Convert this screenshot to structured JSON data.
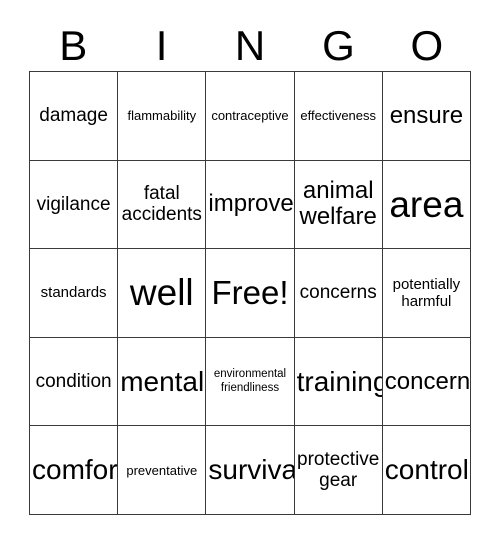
{
  "card": {
    "title": "BINGO",
    "columns": [
      {
        "letter": "B"
      },
      {
        "letter": "I"
      },
      {
        "letter": "N"
      },
      {
        "letter": "G"
      },
      {
        "letter": "O"
      }
    ],
    "colors": {
      "background": "#ffffff",
      "border": "#3a3a3a",
      "text": "#000000"
    },
    "free_space": {
      "row": 2,
      "col": 2,
      "label": "Free!"
    },
    "rows": [
      [
        {
          "text": "damage",
          "size": "ml",
          "lines": 1
        },
        {
          "text": "flammability",
          "size": "xs",
          "lines": 1
        },
        {
          "text": "contraceptive",
          "size": "xs",
          "lines": 1
        },
        {
          "text": "effectiveness",
          "size": "xs",
          "lines": 1
        },
        {
          "text": "ensure",
          "size": "xl",
          "lines": 1
        }
      ],
      [
        {
          "text": "vigilance",
          "size": "ml",
          "lines": 1
        },
        {
          "text": "fatal\naccidents",
          "size": "ml",
          "lines": 2
        },
        {
          "text": "improve",
          "size": "xl",
          "lines": 1
        },
        {
          "text": "animal\nwelfare",
          "size": "xl",
          "lines": 2
        },
        {
          "text": "area",
          "size": "h2",
          "lines": 1
        }
      ],
      [
        {
          "text": "standards",
          "size": "s",
          "lines": 1
        },
        {
          "text": "well",
          "size": "h2",
          "lines": 1
        },
        {
          "text": "Free!",
          "size": "h1",
          "lines": 1
        },
        {
          "text": "concerns",
          "size": "ml",
          "lines": 1
        },
        {
          "text": "potentially\nharmful",
          "size": "s",
          "lines": 2
        }
      ],
      [
        {
          "text": "condition",
          "size": "ml",
          "lines": 1
        },
        {
          "text": "mental",
          "size": "xxl",
          "lines": 1
        },
        {
          "text": "environmental\nfriendliness",
          "size": "xxs",
          "lines": 2
        },
        {
          "text": "training",
          "size": "xxl",
          "lines": 1
        },
        {
          "text": "concern",
          "size": "xl",
          "lines": 1
        }
      ],
      [
        {
          "text": "comfort",
          "size": "xxl",
          "lines": 1
        },
        {
          "text": "preventative",
          "size": "xs",
          "lines": 1
        },
        {
          "text": "survival",
          "size": "xxl",
          "lines": 1
        },
        {
          "text": "protective\ngear",
          "size": "ml",
          "lines": 2
        },
        {
          "text": "control",
          "size": "xxl",
          "lines": 1
        }
      ]
    ]
  }
}
